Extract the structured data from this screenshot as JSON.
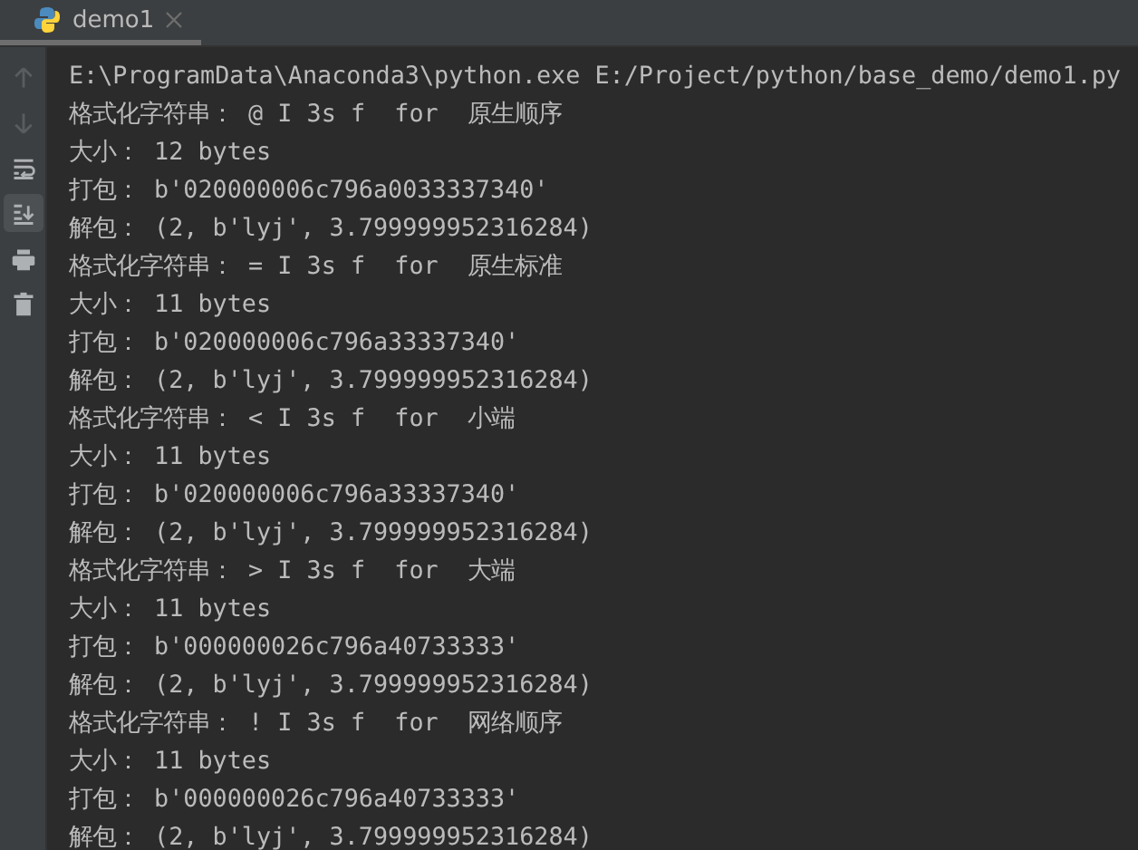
{
  "tabs": [
    {
      "label": "demo1",
      "selected": true
    }
  ],
  "toolbar": [
    {
      "kind": "up",
      "selected": false,
      "disabled": true
    },
    {
      "kind": "down",
      "selected": false,
      "disabled": true
    },
    {
      "kind": "wrap",
      "selected": false,
      "disabled": false
    },
    {
      "kind": "scroll-end",
      "selected": true,
      "disabled": false
    },
    {
      "kind": "print",
      "selected": false,
      "disabled": false
    },
    {
      "kind": "trash",
      "selected": false,
      "disabled": false
    }
  ],
  "console": {
    "lines": [
      "E:\\ProgramData\\Anaconda3\\python.exe E:/Project/python/base_demo/demo1.py",
      "格式化字符串： @ I 3s f  for  原生顺序",
      "大小： 12 bytes",
      "打包： b'020000006c796a0033337340'",
      "解包： (2, b'lyj', 3.799999952316284)",
      "格式化字符串： = I 3s f  for  原生标准",
      "大小： 11 bytes",
      "打包： b'020000006c796a33337340'",
      "解包： (2, b'lyj', 3.799999952316284)",
      "格式化字符串： < I 3s f  for  小端",
      "大小： 11 bytes",
      "打包： b'020000006c796a33337340'",
      "解包： (2, b'lyj', 3.799999952316284)",
      "格式化字符串： > I 3s f  for  大端",
      "大小： 11 bytes",
      "打包： b'000000026c796a40733333'",
      "解包： (2, b'lyj', 3.799999952316284)",
      "格式化字符串： ! I 3s f  for  网络顺序",
      "大小： 11 bytes",
      "打包： b'000000026c796a40733333'",
      "解包： (2, b'lyj', 3.799999952316284)"
    ]
  }
}
